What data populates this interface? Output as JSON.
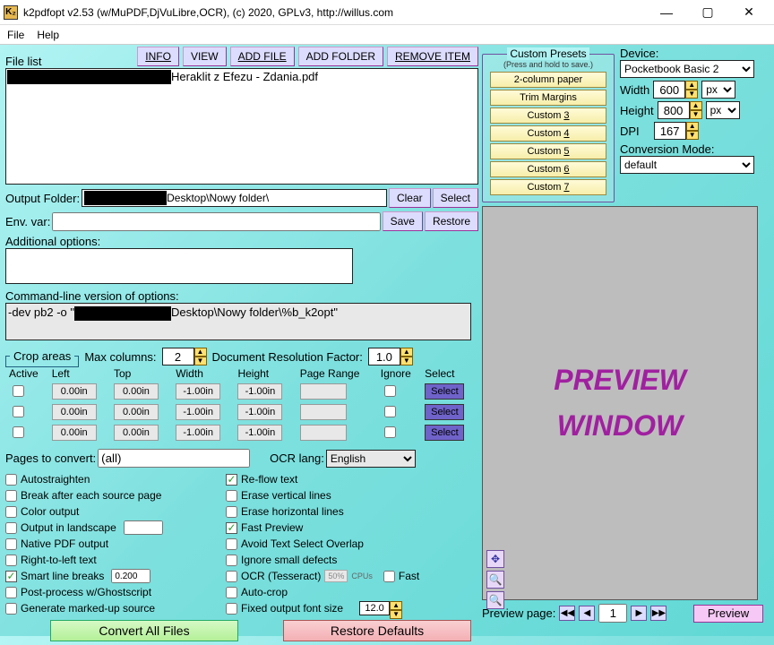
{
  "title": "k2pdfopt v2.53 (w/MuPDF,DjVuLibre,OCR), (c) 2020, GPLv3, http://willus.com",
  "menu": {
    "file": "File",
    "help": "Help"
  },
  "toolbar": {
    "info": "INFO",
    "view": "VIEW",
    "addfile": "ADD FILE",
    "addfolder": "ADD FOLDER",
    "remove": "REMOVE ITEM"
  },
  "file_list": {
    "label": "File list",
    "item0": "Heraklit z Efezu - Zdania.pdf"
  },
  "outfolder": {
    "label": "Output Folder:",
    "suffix": "Desktop\\Nowy folder\\",
    "clear": "Clear",
    "select": "Select"
  },
  "envvar": {
    "label": "Env. var:",
    "save": "Save",
    "restore": "Restore"
  },
  "addopt": {
    "label": "Additional options:"
  },
  "cmdline": {
    "label": "Command-line version of options:",
    "prefix": "-dev pb2 -o \"",
    "suffix": "Desktop\\Nowy folder\\%b_k2opt\""
  },
  "crop": {
    "legend": "Crop areas",
    "maxcol_label": "Max columns:",
    "maxcol": "2",
    "drf_label": "Document Resolution Factor:",
    "drf": "1.0",
    "hdr": {
      "active": "Active",
      "left": "Left",
      "top": "Top",
      "width": "Width",
      "height": "Height",
      "pr": "Page Range",
      "ignore": "Ignore",
      "select": "Select"
    },
    "r": {
      "left": "0.00in",
      "top": "0.00in",
      "width": "-1.00in",
      "height": "-1.00in",
      "sel": "Select"
    }
  },
  "pages": {
    "label": "Pages to convert:",
    "value": "(all)",
    "ocrlang_label": "OCR lang:",
    "ocrlang": "English"
  },
  "cb": {
    "autostraighten": "Autostraighten",
    "break": "Break after each source page",
    "color": "Color output",
    "landscape": "Output in landscape",
    "native": "Native PDF output",
    "rtl": "Right-to-left text",
    "smart": "Smart line breaks",
    "smart_v": "0.200",
    "post": "Post-process w/Ghostscript",
    "markup": "Generate marked-up source",
    "reflow": "Re-flow text",
    "evert": "Erase vertical lines",
    "ehoriz": "Erase horizontal lines",
    "fastprev": "Fast Preview",
    "avoid": "Avoid Text Select Overlap",
    "ignoresmall": "Ignore small defects",
    "ocrtess": "OCR (Tesseract)",
    "ocrcpu": "50%",
    "ocrcpu2": "CPUs",
    "fast": "Fast",
    "autocrop": "Auto-crop",
    "fixedfont": "Fixed output font size",
    "fixedfont_v": "12.0"
  },
  "convert": "Convert All Files",
  "restore_def": "Restore Defaults",
  "presets": {
    "legend": "Custom Presets",
    "hint": "(Press and hold to save.)",
    "p1": "2-column paper",
    "p2": "Trim Margins",
    "p3": "Custom 3",
    "p4": "Custom 4",
    "p5": "Custom 5",
    "p6": "Custom 6",
    "p7": "Custom 7"
  },
  "device": {
    "label": "Device:",
    "name": "Pocketbook Basic 2",
    "width_l": "Width",
    "width": "600",
    "height_l": "Height",
    "height": "800",
    "unit": "px",
    "dpi_l": "DPI",
    "dpi": "167",
    "mode_l": "Conversion Mode:",
    "mode": "default"
  },
  "preview": {
    "win1": "PREVIEW",
    "win2": "WINDOW",
    "label": "Preview page:",
    "page": "1",
    "btn": "Preview"
  }
}
